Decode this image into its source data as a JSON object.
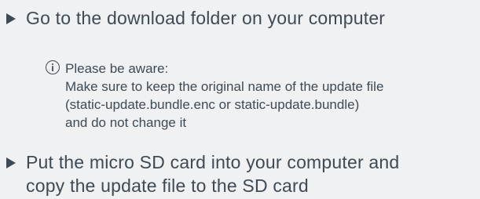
{
  "steps": [
    {
      "text": "Go to the download folder on your computer"
    },
    {
      "text": "Put the micro SD card into your computer and\ncopy the update file to the SD card"
    }
  ],
  "notice": {
    "icon": "info-icon",
    "title": "Please be aware:",
    "lines": [
      "Make sure to keep the original name of the update file",
      "(static-update.bundle.enc or static-update.bundle)",
      "and do not change it"
    ]
  }
}
